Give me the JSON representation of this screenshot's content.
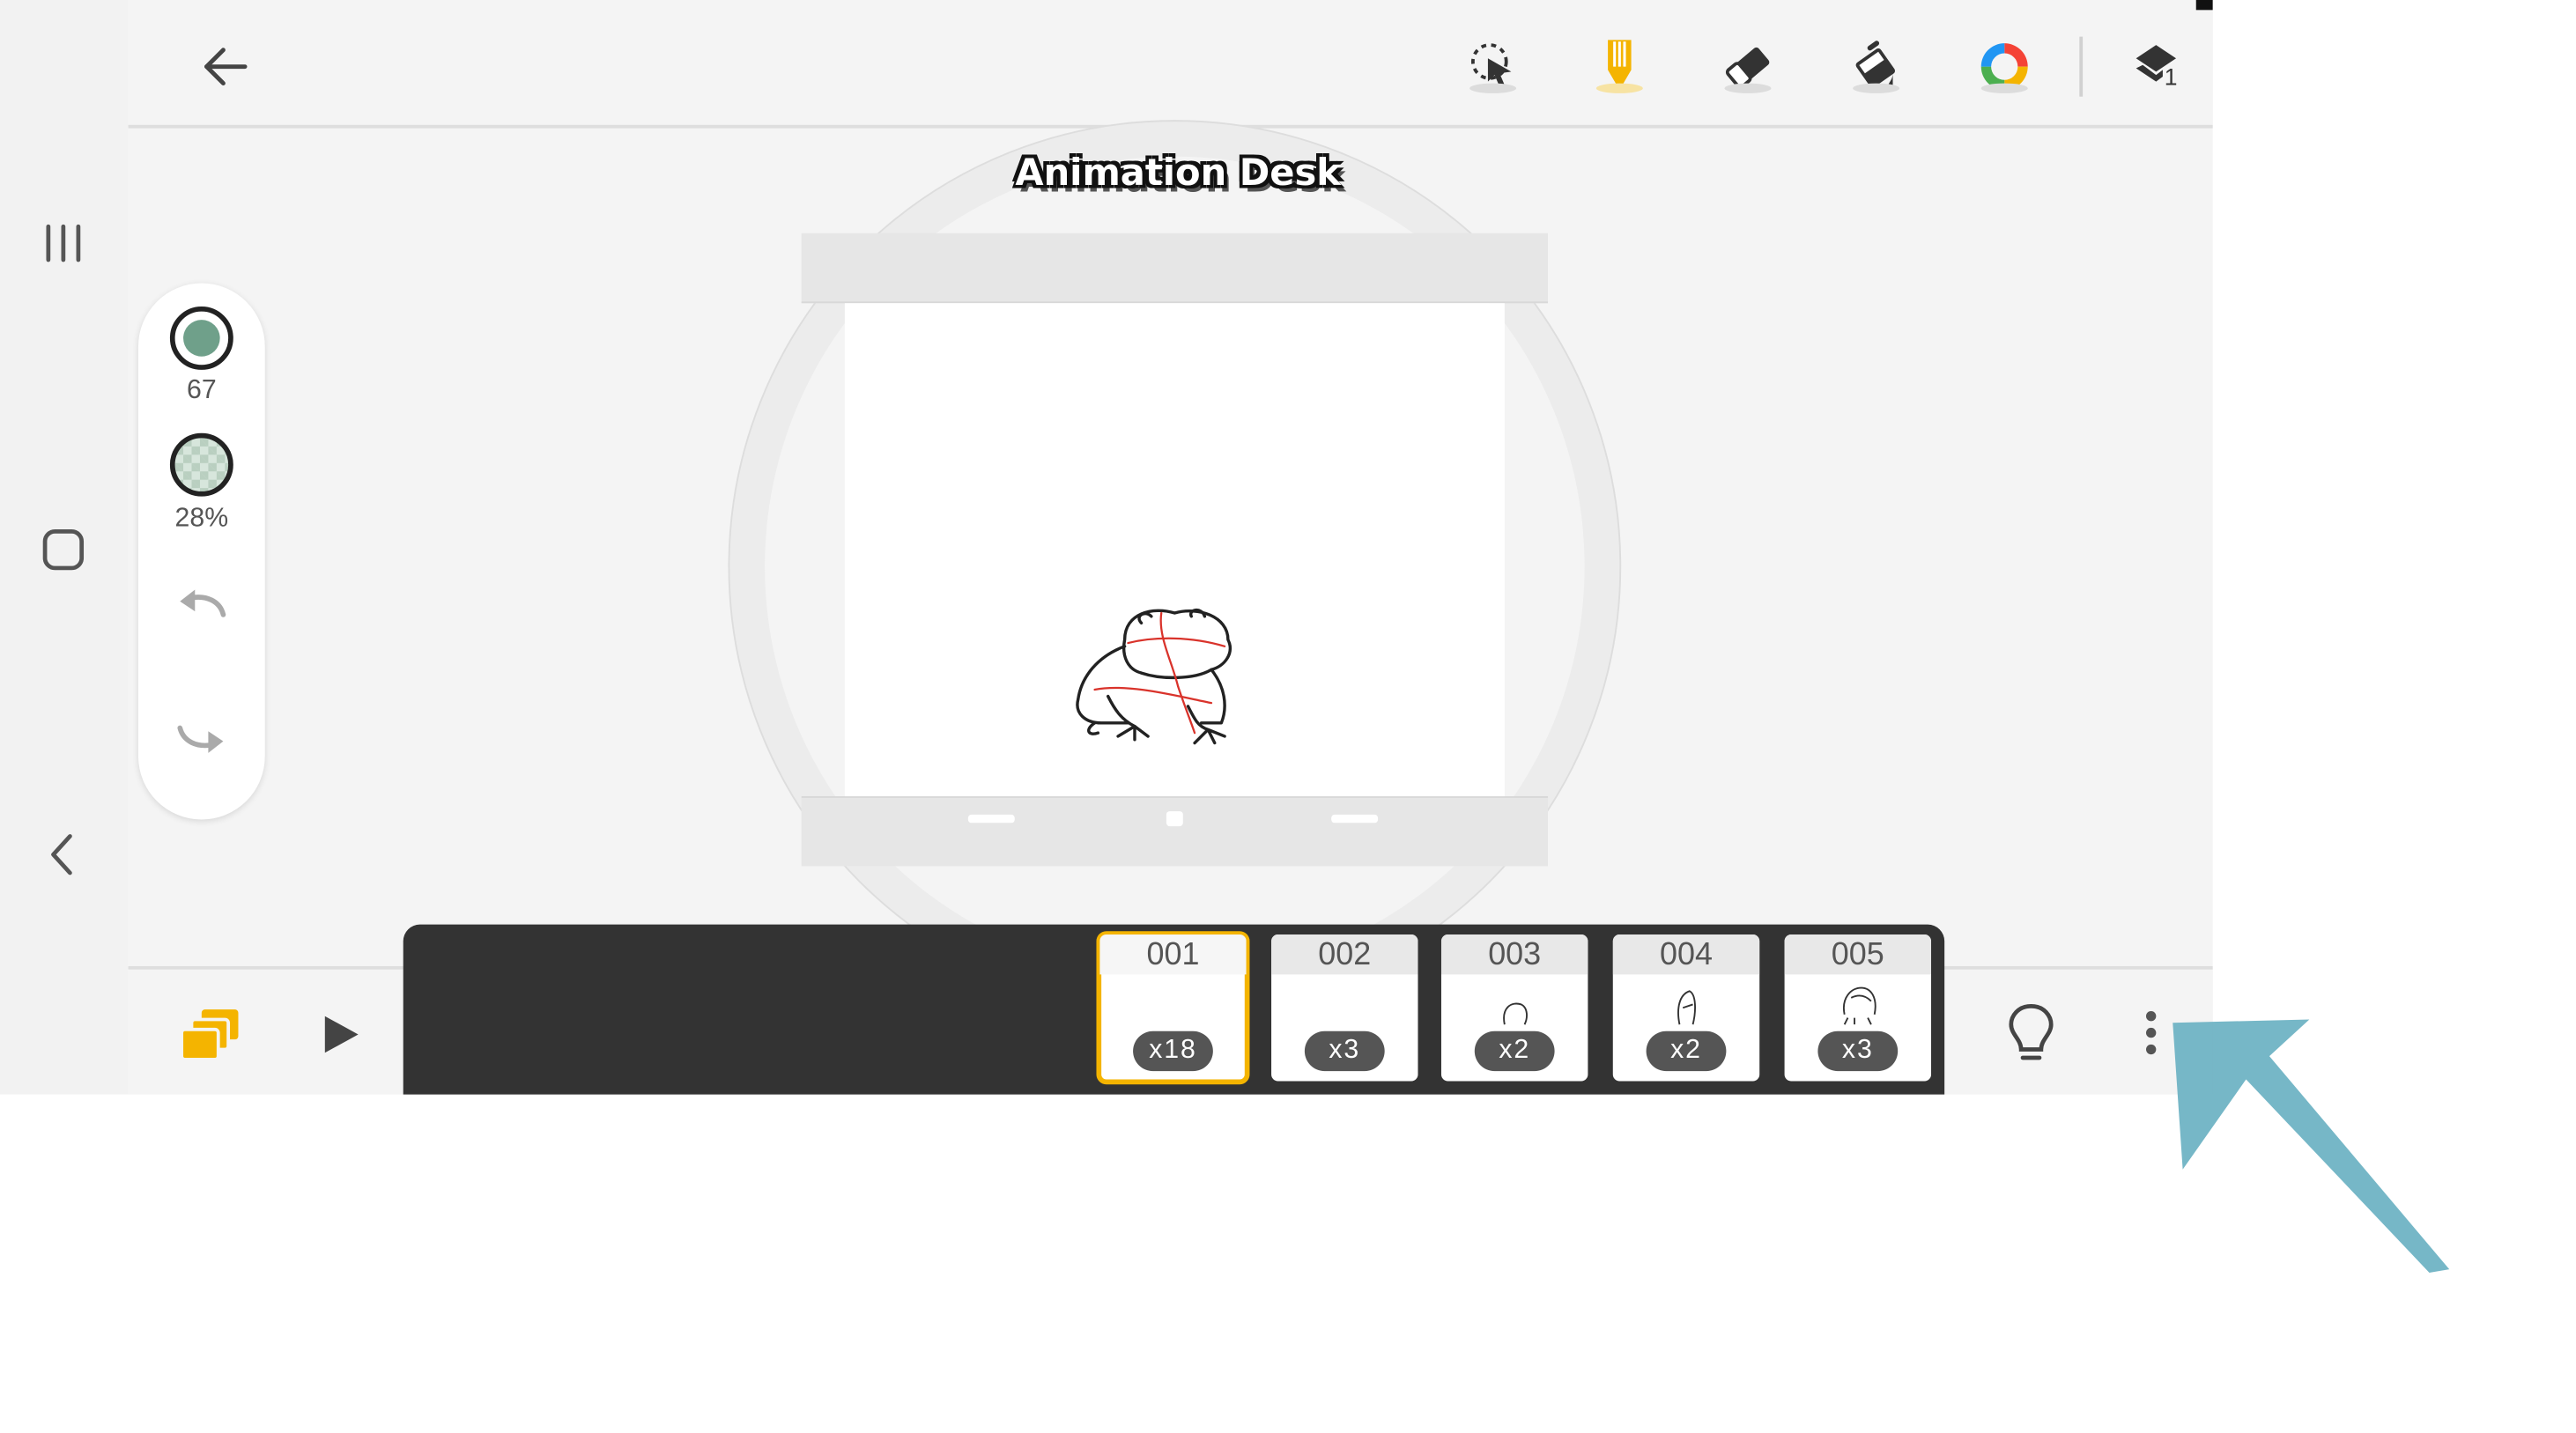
{
  "system_nav": {
    "icons": [
      "recent-apps-icon",
      "home-icon",
      "back-icon"
    ]
  },
  "toolbar": {
    "back_icon": "arrow-left-icon",
    "tools": [
      {
        "name": "lasso-select-tool",
        "icon": "lasso-icon"
      },
      {
        "name": "pencil-tool",
        "icon": "pencil-icon",
        "active": true,
        "color": "#f4b400"
      },
      {
        "name": "eraser-tool",
        "icon": "eraser-icon"
      },
      {
        "name": "paint-bucket-tool",
        "icon": "paint-bucket-icon"
      },
      {
        "name": "color-wheel-tool",
        "icon": "color-wheel-icon"
      }
    ],
    "layer_button": {
      "icon": "layer-icon",
      "count": "1"
    }
  },
  "left_panel": {
    "brush_size": {
      "color": "#6fa08a",
      "value": "67"
    },
    "opacity": {
      "value": "28%"
    },
    "undo_icon": "undo-icon",
    "redo_icon": "redo-icon"
  },
  "canvas": {
    "logo_text": "Animation Desk",
    "drawing": "frog-sketch"
  },
  "bottom_bar": {
    "frames_icon": "stacked-frames-icon",
    "play_icon": "play-icon",
    "frames": [
      {
        "number": "001",
        "badge": "x18",
        "selected": true
      },
      {
        "number": "002",
        "badge": "x3"
      },
      {
        "number": "003",
        "badge": "x2"
      },
      {
        "number": "004",
        "badge": "x2"
      },
      {
        "number": "005",
        "badge": "x3"
      }
    ],
    "tips_icon": "lightbulb-icon",
    "more_icon": "more-vertical-icon"
  },
  "colors": {
    "accent": "#f4b400",
    "arrow_annotation": "#6fb3c4"
  }
}
